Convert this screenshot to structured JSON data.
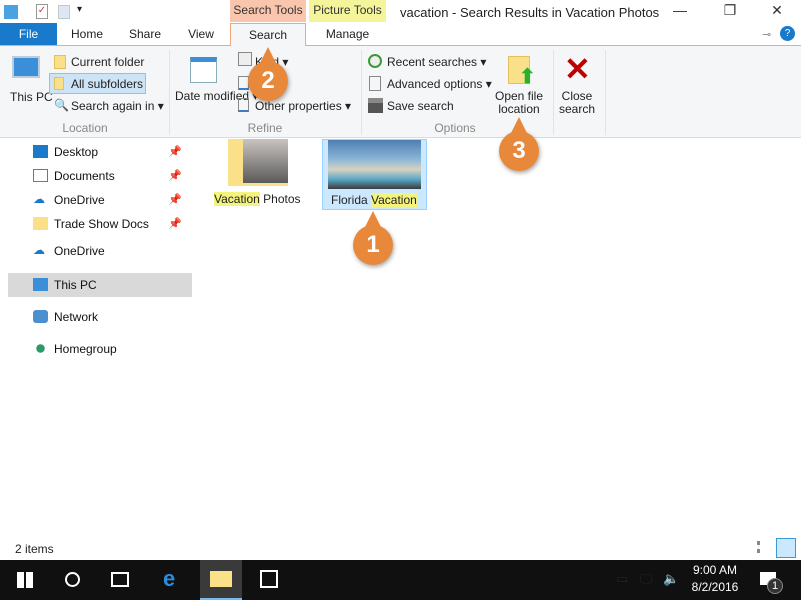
{
  "window": {
    "title": "vacation - Search Results in Vacation Photos",
    "context_tabs": [
      "Search Tools",
      "Picture Tools"
    ]
  },
  "tabs": [
    "File",
    "Home",
    "Share",
    "View",
    "Search",
    "Manage"
  ],
  "ribbon": {
    "location": {
      "label": "Location",
      "this_pc": "This PC",
      "current_folder": "Current folder",
      "all_subfolders": "All subfolders",
      "search_again": "Search again in"
    },
    "refine": {
      "label": "Refine",
      "date_modified": "Date modified",
      "kind": "Kind",
      "other_properties": "Other properties"
    },
    "options": {
      "label": "Options",
      "recent_searches": "Recent searches",
      "advanced_options": "Advanced options",
      "save_search": "Save search",
      "open_file_location": "Open file location"
    },
    "close_search": "Close search"
  },
  "nav": [
    "Desktop",
    "Documents",
    "OneDrive",
    "Trade Show Docs",
    "OneDrive",
    "This PC",
    "Network",
    "Homegroup"
  ],
  "files": [
    {
      "name_pre": "",
      "name_hl": "Vacation",
      "name_post": " Photos"
    },
    {
      "name_pre": "Florida ",
      "name_hl": "Vacation",
      "name_post": ""
    }
  ],
  "status": "2 items",
  "taskbar": {
    "time": "9:00 AM",
    "date": "8/2/2016",
    "notifications": "1"
  },
  "callouts": [
    "1",
    "2",
    "3"
  ],
  "colors": {
    "accent": "#1979ca",
    "callout": "#e8883a",
    "highlight": "#f4f47c"
  }
}
